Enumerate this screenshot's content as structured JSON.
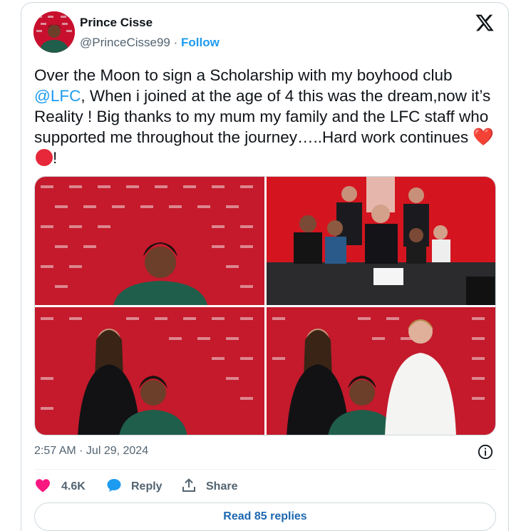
{
  "author": {
    "display_name": "Prince Cisse",
    "handle": "@PrinceCisse99",
    "separator": "·",
    "follow_label": "Follow"
  },
  "tweet": {
    "text_part1": "Over the Moon to sign a Scholarship with my boyhood club ",
    "mention": "@LFC",
    "text_part2": ", When i joined at the age of 4 this was the dream,now it’s  Reality ! Big thanks to my mum my family and the LFC staff who supported me throughout the journey…..Hard work continues ",
    "heart_emoji": "❤️",
    "text_end": "!"
  },
  "meta": {
    "timestamp": "2:57 AM · Jul 29, 2024"
  },
  "actions": {
    "like_count": "4.6K",
    "reply_label": "Reply",
    "share_label": "Share"
  },
  "read_replies_label": "Read 85 replies",
  "icons": {
    "brand": "x-logo-icon",
    "like": "heart-icon",
    "reply": "speech-bubble-icon",
    "share": "share-upload-icon",
    "info": "info-icon"
  },
  "colors": {
    "accent": "#1d9bf0",
    "like": "#f91880",
    "muted_text": "#536471",
    "backdrop_red": "#c8102e"
  }
}
